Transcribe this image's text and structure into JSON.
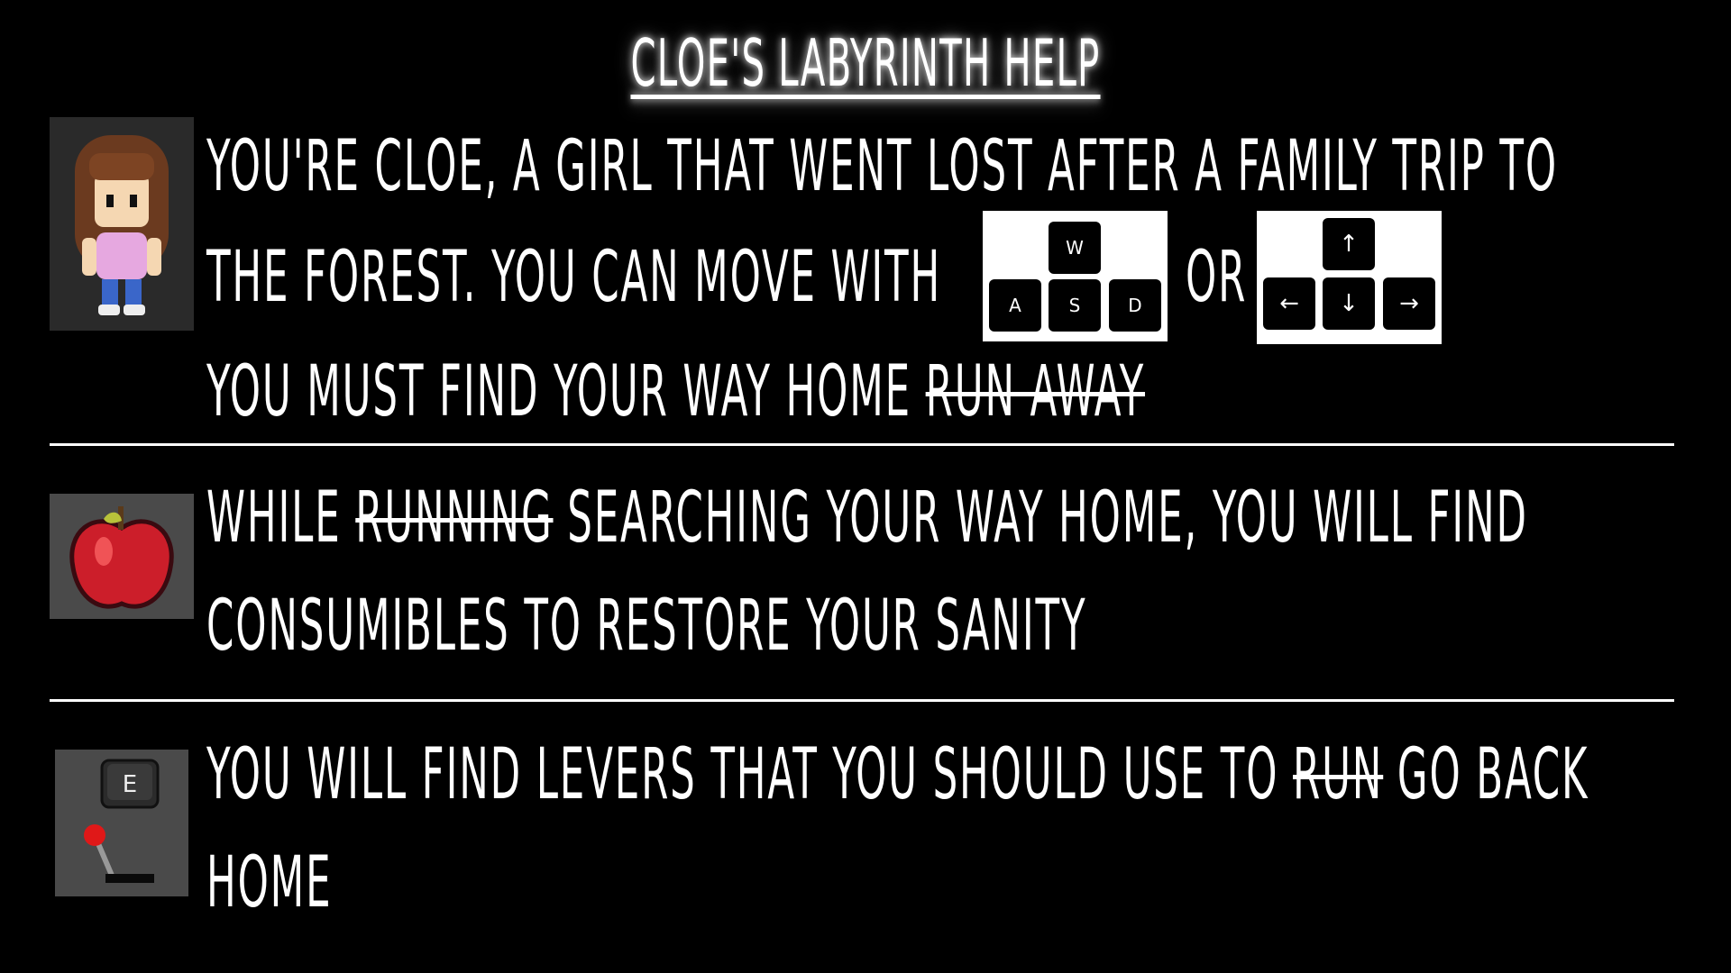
{
  "title": "Cloe's Labyrinth Help",
  "section1": {
    "line1": "You're Cloe, a girl that went lost after a family trip to",
    "line2": "the forest. You can move with",
    "or": "or",
    "line3": "You must find your way home",
    "line3_strike": "run away",
    "wasd": {
      "w": "W",
      "a": "A",
      "s": "S",
      "d": "D"
    },
    "arrows": {
      "up": "↑",
      "left": "←",
      "down": "↓",
      "right": "→"
    }
  },
  "section2": {
    "line1_a": "While",
    "line1_strike": "running",
    "line1_b": "searching your way home, you will find",
    "line2": "consumibles to restore your sanity"
  },
  "section3": {
    "line1_a": "You will find levers that you should use to",
    "line1_strike": "run",
    "line1_b": "go back",
    "line2": "home",
    "e_key": "E"
  }
}
